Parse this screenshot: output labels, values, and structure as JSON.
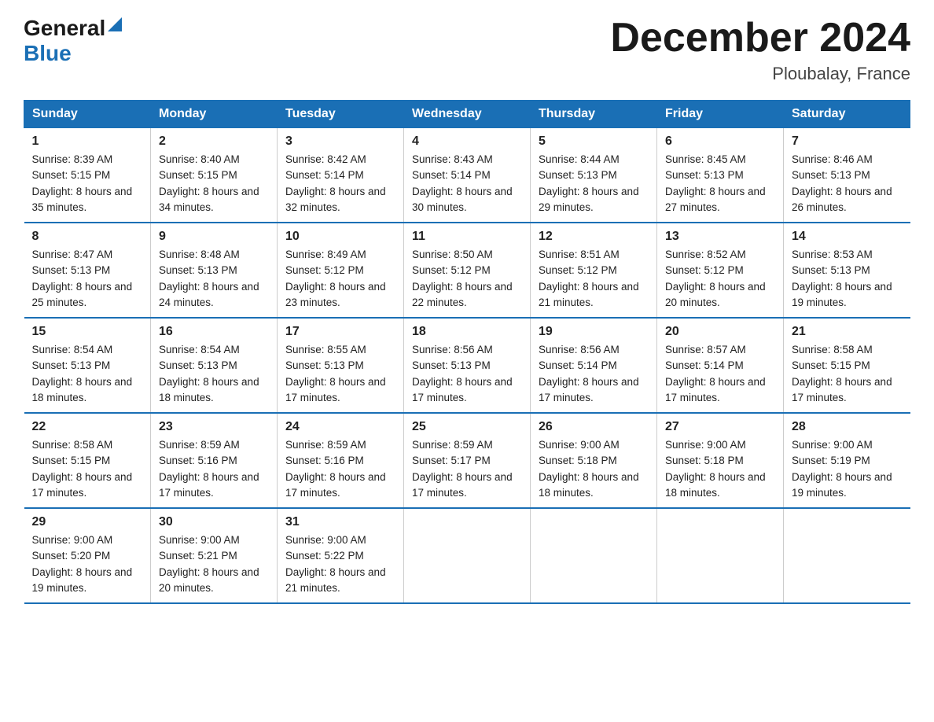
{
  "header": {
    "logo_general": "General",
    "logo_blue": "Blue",
    "title": "December 2024",
    "location": "Ploubalay, France"
  },
  "days_of_week": [
    "Sunday",
    "Monday",
    "Tuesday",
    "Wednesday",
    "Thursday",
    "Friday",
    "Saturday"
  ],
  "weeks": [
    [
      {
        "day": "1",
        "sunrise": "8:39 AM",
        "sunset": "5:15 PM",
        "daylight": "8 hours and 35 minutes."
      },
      {
        "day": "2",
        "sunrise": "8:40 AM",
        "sunset": "5:15 PM",
        "daylight": "8 hours and 34 minutes."
      },
      {
        "day": "3",
        "sunrise": "8:42 AM",
        "sunset": "5:14 PM",
        "daylight": "8 hours and 32 minutes."
      },
      {
        "day": "4",
        "sunrise": "8:43 AM",
        "sunset": "5:14 PM",
        "daylight": "8 hours and 30 minutes."
      },
      {
        "day": "5",
        "sunrise": "8:44 AM",
        "sunset": "5:13 PM",
        "daylight": "8 hours and 29 minutes."
      },
      {
        "day": "6",
        "sunrise": "8:45 AM",
        "sunset": "5:13 PM",
        "daylight": "8 hours and 27 minutes."
      },
      {
        "day": "7",
        "sunrise": "8:46 AM",
        "sunset": "5:13 PM",
        "daylight": "8 hours and 26 minutes."
      }
    ],
    [
      {
        "day": "8",
        "sunrise": "8:47 AM",
        "sunset": "5:13 PM",
        "daylight": "8 hours and 25 minutes."
      },
      {
        "day": "9",
        "sunrise": "8:48 AM",
        "sunset": "5:13 PM",
        "daylight": "8 hours and 24 minutes."
      },
      {
        "day": "10",
        "sunrise": "8:49 AM",
        "sunset": "5:12 PM",
        "daylight": "8 hours and 23 minutes."
      },
      {
        "day": "11",
        "sunrise": "8:50 AM",
        "sunset": "5:12 PM",
        "daylight": "8 hours and 22 minutes."
      },
      {
        "day": "12",
        "sunrise": "8:51 AM",
        "sunset": "5:12 PM",
        "daylight": "8 hours and 21 minutes."
      },
      {
        "day": "13",
        "sunrise": "8:52 AM",
        "sunset": "5:12 PM",
        "daylight": "8 hours and 20 minutes."
      },
      {
        "day": "14",
        "sunrise": "8:53 AM",
        "sunset": "5:13 PM",
        "daylight": "8 hours and 19 minutes."
      }
    ],
    [
      {
        "day": "15",
        "sunrise": "8:54 AM",
        "sunset": "5:13 PM",
        "daylight": "8 hours and 18 minutes."
      },
      {
        "day": "16",
        "sunrise": "8:54 AM",
        "sunset": "5:13 PM",
        "daylight": "8 hours and 18 minutes."
      },
      {
        "day": "17",
        "sunrise": "8:55 AM",
        "sunset": "5:13 PM",
        "daylight": "8 hours and 17 minutes."
      },
      {
        "day": "18",
        "sunrise": "8:56 AM",
        "sunset": "5:13 PM",
        "daylight": "8 hours and 17 minutes."
      },
      {
        "day": "19",
        "sunrise": "8:56 AM",
        "sunset": "5:14 PM",
        "daylight": "8 hours and 17 minutes."
      },
      {
        "day": "20",
        "sunrise": "8:57 AM",
        "sunset": "5:14 PM",
        "daylight": "8 hours and 17 minutes."
      },
      {
        "day": "21",
        "sunrise": "8:58 AM",
        "sunset": "5:15 PM",
        "daylight": "8 hours and 17 minutes."
      }
    ],
    [
      {
        "day": "22",
        "sunrise": "8:58 AM",
        "sunset": "5:15 PM",
        "daylight": "8 hours and 17 minutes."
      },
      {
        "day": "23",
        "sunrise": "8:59 AM",
        "sunset": "5:16 PM",
        "daylight": "8 hours and 17 minutes."
      },
      {
        "day": "24",
        "sunrise": "8:59 AM",
        "sunset": "5:16 PM",
        "daylight": "8 hours and 17 minutes."
      },
      {
        "day": "25",
        "sunrise": "8:59 AM",
        "sunset": "5:17 PM",
        "daylight": "8 hours and 17 minutes."
      },
      {
        "day": "26",
        "sunrise": "9:00 AM",
        "sunset": "5:18 PM",
        "daylight": "8 hours and 18 minutes."
      },
      {
        "day": "27",
        "sunrise": "9:00 AM",
        "sunset": "5:18 PM",
        "daylight": "8 hours and 18 minutes."
      },
      {
        "day": "28",
        "sunrise": "9:00 AM",
        "sunset": "5:19 PM",
        "daylight": "8 hours and 19 minutes."
      }
    ],
    [
      {
        "day": "29",
        "sunrise": "9:00 AM",
        "sunset": "5:20 PM",
        "daylight": "8 hours and 19 minutes."
      },
      {
        "day": "30",
        "sunrise": "9:00 AM",
        "sunset": "5:21 PM",
        "daylight": "8 hours and 20 minutes."
      },
      {
        "day": "31",
        "sunrise": "9:00 AM",
        "sunset": "5:22 PM",
        "daylight": "8 hours and 21 minutes."
      },
      {
        "day": "",
        "sunrise": "",
        "sunset": "",
        "daylight": ""
      },
      {
        "day": "",
        "sunrise": "",
        "sunset": "",
        "daylight": ""
      },
      {
        "day": "",
        "sunrise": "",
        "sunset": "",
        "daylight": ""
      },
      {
        "day": "",
        "sunrise": "",
        "sunset": "",
        "daylight": ""
      }
    ]
  ]
}
